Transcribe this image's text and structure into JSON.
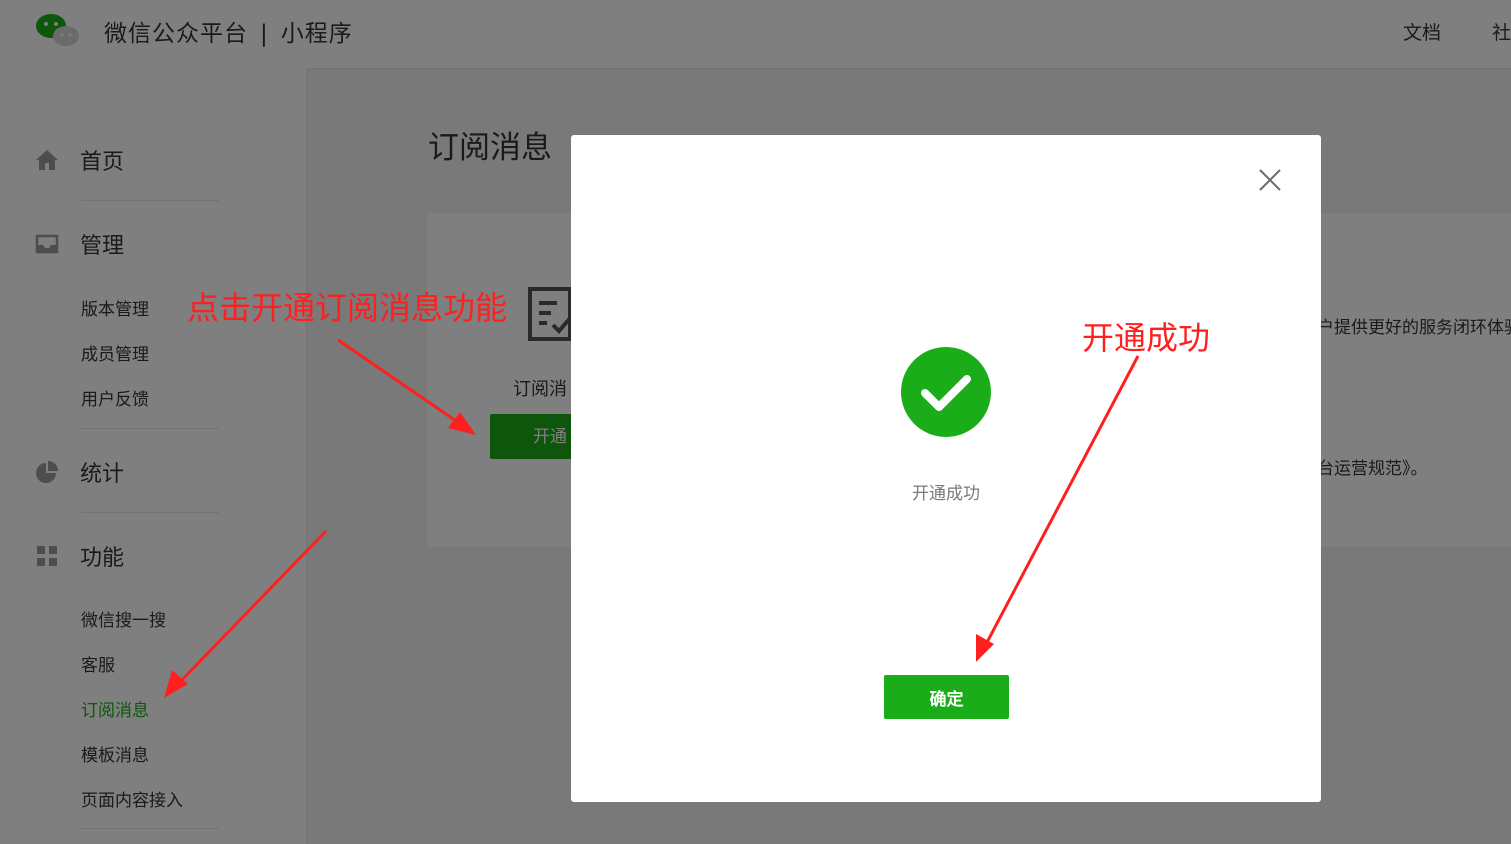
{
  "header": {
    "platform": "微信公众平台",
    "separator": "|",
    "product": "小程序",
    "links": [
      "文档",
      "社"
    ]
  },
  "sidebar": {
    "sections": [
      {
        "label": "首页",
        "icon": "home-icon"
      },
      {
        "label": "管理",
        "icon": "inbox-icon",
        "items": [
          "版本管理",
          "成员管理",
          "用户反馈"
        ]
      },
      {
        "label": "统计",
        "icon": "pie-chart-icon"
      },
      {
        "label": "功能",
        "icon": "grid-icon",
        "items": [
          "微信搜一搜",
          "客服",
          "订阅消息",
          "模板消息",
          "页面内容接入"
        ]
      }
    ],
    "active_item": "订阅消息"
  },
  "main": {
    "title": "订阅消息",
    "card_label": "订阅消",
    "card_button": "开通",
    "desc_line1": "户提供更好的服务闭环体验",
    "desc_line2": "台运营规范》。"
  },
  "modal": {
    "message": "开通成功",
    "confirm": "确定"
  },
  "annotations": {
    "left_note": "点击开通订阅消息功能",
    "right_note": "开通成功",
    "color": "#ff1f1f"
  },
  "colors": {
    "accent": "#1aad19",
    "overlay": "rgba(0,0,0,0.5)"
  }
}
